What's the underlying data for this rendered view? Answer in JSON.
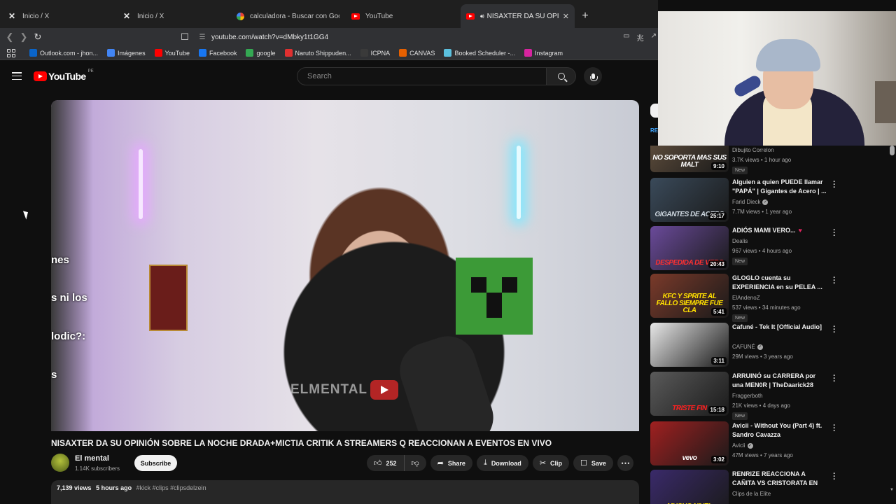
{
  "browser": {
    "tabs": [
      {
        "label": "Inicio / X",
        "icon": "x-logo-icon",
        "active": false
      },
      {
        "label": "Inicio / X",
        "icon": "x-logo-icon",
        "active": false
      },
      {
        "label": "calculadora - Buscar con Google",
        "icon": "google-icon",
        "active": false
      },
      {
        "label": "YouTube",
        "icon": "youtube-icon",
        "active": false
      },
      {
        "label": "NISAXTER DA SU OPINIÓN S",
        "icon": "youtube-icon",
        "active": true
      }
    ],
    "url": "youtube.com/watch?v=dMbky1t1GG4",
    "bookmarks": [
      {
        "label": "Outlook.com - jhon...",
        "color": "#0a64c8"
      },
      {
        "label": "Imágenes",
        "color": "#4285f4"
      },
      {
        "label": "YouTube",
        "color": "#ff0000"
      },
      {
        "label": "Facebook",
        "color": "#1877f2"
      },
      {
        "label": "google",
        "color": "#34a853"
      },
      {
        "label": "Naruto Shippuden...",
        "color": "#e03030"
      },
      {
        "label": "ICPNA",
        "color": "#3a3a3a"
      },
      {
        "label": "CANVAS",
        "color": "#e66000"
      },
      {
        "label": "Booked Scheduler -...",
        "color": "#5bc0de"
      },
      {
        "label": "Instagram",
        "color": "#d6249f"
      }
    ]
  },
  "youtube": {
    "logo_text": "YouTube",
    "country_code": "PE",
    "search_placeholder": "Search"
  },
  "player": {
    "overlay_texts": [
      "nes",
      "s ni los",
      "lodic?:",
      "s"
    ],
    "watermark": "ELMENTAL"
  },
  "video": {
    "title": "NISAXTER DA SU OPINIÓN SOBRE LA NOCHE DRADA+MICTIA CRITIK A STREAMERS Q REACCIONAN A EVENTOS EN VIVO",
    "channel": "El mental",
    "subscribers": "1.14K subscribers",
    "subscribe_label": "Subscribe",
    "likes": "252",
    "share_label": "Share",
    "download_label": "Download",
    "clip_label": "Clip",
    "save_label": "Save",
    "views": "7,139 views",
    "age": "5 hours ago",
    "tags": "#kick #clips #clipsdelzein"
  },
  "sidebar": {
    "chip_label": "RE",
    "items": [
      {
        "title": "",
        "channel": "Dibujito Correlon",
        "stats": "3.7K views • 1 hour ago",
        "new": "New",
        "duration": "9:10",
        "thumb_text": "NO SOPORTA MAS SUS MALT",
        "thumb_bg": "#5a4a3a",
        "thumb_color": "#ffffff"
      },
      {
        "title": "Alguien a quien PUEDE llamar \"PAPÁ\" | Gigantes de Acero | ...",
        "channel": "Farid Dieck",
        "verified": true,
        "stats": "7.7M views • 1 year ago",
        "duration": "25:17",
        "thumb_text": "GIGANTES DE ACERO",
        "thumb_bg": "#3a4a5a",
        "thumb_color": "#cfd8e0"
      },
      {
        "title": "ADIÓS MAMI VERO...",
        "heart": "♥",
        "channel": "Dealis",
        "stats": "967 views • 4 hours ago",
        "new": "New",
        "duration": "20:43",
        "thumb_text": "DESPEDIDA DE VERO",
        "thumb_bg": "#6a4a9a",
        "thumb_color": "#ff3030"
      },
      {
        "title": "GLOGLO cuenta su EXPERIENCIA en su PELEA ...",
        "channel": "ElAndenoZ",
        "stats": "537 views • 34 minutes ago",
        "new": "New",
        "duration": "5:41",
        "thumb_text": "KFC Y SPRITE AL FALLO SIEMPRE FUE CLA",
        "thumb_bg": "#7a3a2a",
        "thumb_color": "#ffe000"
      },
      {
        "title": "Cafuné - Tek It [Official Audio]",
        "channel": "CAFUNÉ",
        "verified": true,
        "stats": "29M views • 3 years ago",
        "duration": "3:11",
        "thumb_text": "",
        "thumb_bg": "#e8e8e8",
        "thumb_color": "#222222"
      },
      {
        "title": "ARRUINÓ su CARRERA por una MEN0R | TheDaarick28",
        "channel": "Fraggerboth",
        "stats": "21K views • 4 days ago",
        "new": "New",
        "duration": "15:18",
        "thumb_text": "TRISTE FIN",
        "thumb_bg": "#5a5a5a",
        "thumb_color": "#ff2020"
      },
      {
        "title": "Avicii - Without You (Part 4) ft. Sandro Cavazza",
        "channel": "Avicii",
        "verified": true,
        "stats": "47M views • 7 years ago",
        "duration": "3:02",
        "thumb_text": "vevo",
        "thumb_bg": "#a02020",
        "thumb_color": "#ffffff"
      },
      {
        "title": "RENRIZE REACCIONA A CAÑITA VS CRISTORATA EN LA NOCH...",
        "channel": "Clips de la Elite",
        "stats": "",
        "duration": "",
        "thumb_text": "MUCHO NIVEL",
        "thumb_bg": "#3a2a6a",
        "thumb_color": "#ffe000"
      }
    ]
  }
}
